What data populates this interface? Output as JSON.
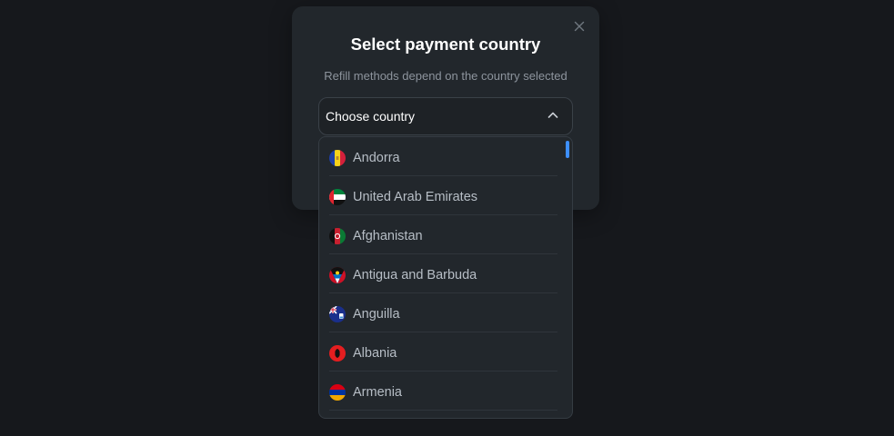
{
  "modal": {
    "title": "Select payment country",
    "subtitle": "Refill methods depend on the country selected",
    "close_icon": "close-icon"
  },
  "select": {
    "label": "Choose country",
    "chevron_icon": "chevron-up-icon"
  },
  "countries": [
    {
      "name": "Andorra",
      "flag": "andorra-flag-icon"
    },
    {
      "name": "United Arab Emirates",
      "flag": "uae-flag-icon"
    },
    {
      "name": "Afghanistan",
      "flag": "afghanistan-flag-icon"
    },
    {
      "name": "Antigua and Barbuda",
      "flag": "antigua-flag-icon"
    },
    {
      "name": "Anguilla",
      "flag": "anguilla-flag-icon"
    },
    {
      "name": "Albania",
      "flag": "albania-flag-icon"
    },
    {
      "name": "Armenia",
      "flag": "armenia-flag-icon"
    }
  ],
  "colors": {
    "background": "#16181c",
    "modal": "#22272c",
    "accent": "#3d8fff"
  }
}
